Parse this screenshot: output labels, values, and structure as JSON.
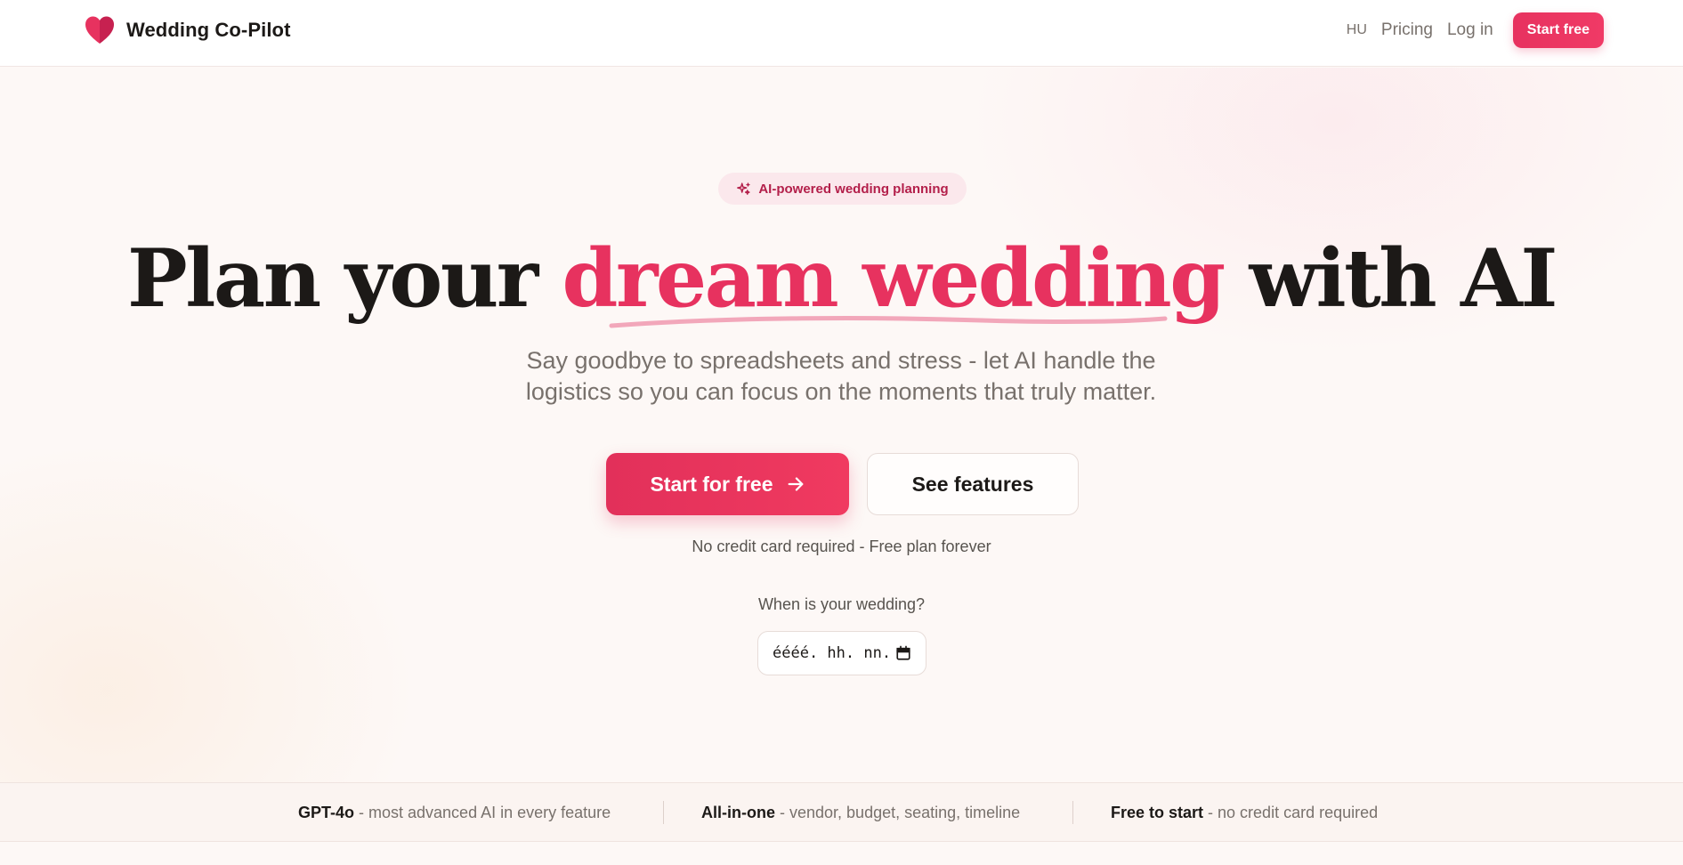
{
  "header": {
    "brand": "Wedding Co-Pilot",
    "logo_icon": "heart-icon",
    "language": "HU",
    "nav": [
      {
        "label": "Pricing"
      },
      {
        "label": "Log in"
      }
    ],
    "cta_label": "Start free"
  },
  "hero": {
    "badge_icon": "sparkles-icon",
    "badge_text": "AI-powered wedding planning",
    "headline_before": "Plan your ",
    "headline_accent": "dream wedding",
    "headline_after": " with AI",
    "subtitle": "Say goodbye to spreadsheets and stress - let AI handle the logistics so you can focus on the moments that truly matter.",
    "primary_button": "Start for free",
    "secondary_button": "See features",
    "note": "No credit card required - Free plan forever",
    "date_label": "When is your wedding?",
    "date_placeholder": "éééé. hh. nn."
  },
  "features_strip": [
    {
      "title": "GPT-4o",
      "desc": " - most advanced AI in every feature"
    },
    {
      "title": "All-in-one",
      "desc": " - vendor, budget, seating, timeline"
    },
    {
      "title": "Free to start",
      "desc": " - no credit card required"
    }
  ],
  "colors": {
    "accent": "#e7325f",
    "background": "#fdf8f6",
    "text": "#1c1917",
    "muted": "#78716c"
  }
}
